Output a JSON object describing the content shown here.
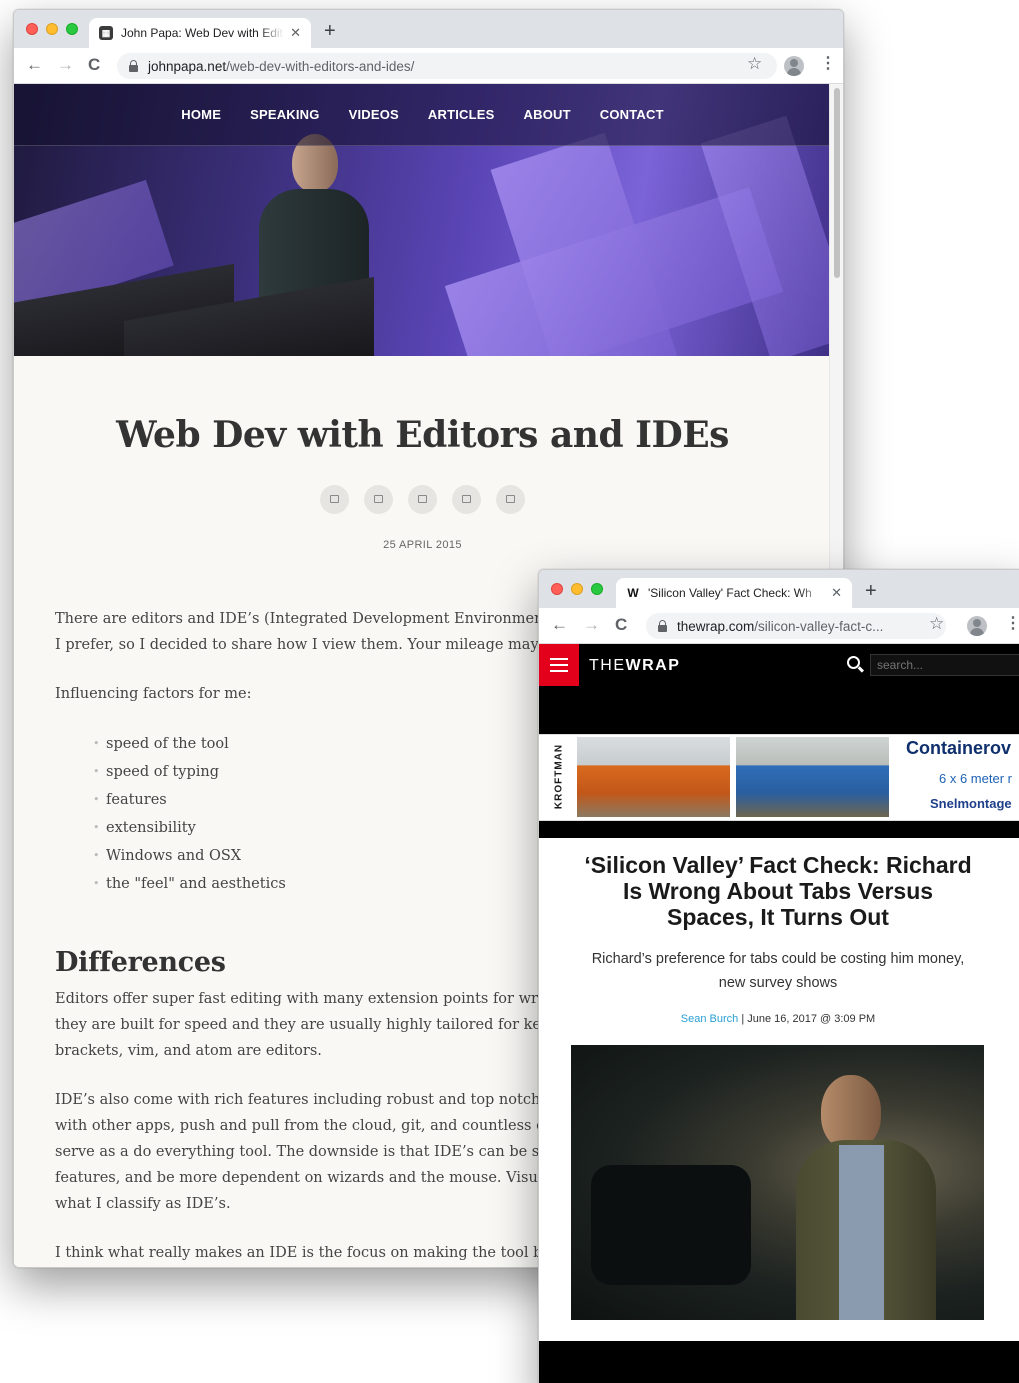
{
  "window1": {
    "tab_title": "John Papa: Web Dev with Editors and IDEs",
    "url_host": "johnpapa.net",
    "url_path": "/web-dev-with-editors-and-ides/",
    "nav": [
      "HOME",
      "SPEAKING",
      "VIDEOS",
      "ARTICLES",
      "ABOUT",
      "CONTACT"
    ],
    "post_title": "Web Dev with Editors and IDEs",
    "post_date": "25 APRIL 2015",
    "intro_line1": "There are editors and IDE’s (Integrated Development Environments)",
    "intro_line2": "I prefer, so I decided to share how I view them. Your mileage may var",
    "factors_intro": "Influencing factors for me:",
    "factors": [
      "speed of the tool",
      "speed of typing",
      "features",
      "extensibility",
      "Windows and OSX",
      "the \"feel\" and aesthetics"
    ],
    "heading_differences": "Differences",
    "editors_line1": "Editors offer super fast editing with many extension points for writi",
    "editors_line2": "they are built for speed and they are usually highly tailored for keyb",
    "editors_line3": "brackets, vim, and atom are editors.",
    "ides_line1": "IDE’s also come with rich features including robust and top notch de",
    "ides_line2": "with other apps, push and pull from the cloud, git, and countless oth",
    "ides_line3": "serve as a do everything tool. The downside is that IDE’s can be slow",
    "ides_line4": "features, and be more dependent on wizards and the mouse. Visual S",
    "ides_line5": "what I classify as IDE’s.",
    "last_line": "I think what really makes an IDE is the focus on making the tool be t"
  },
  "window2": {
    "tab_title": "'Silicon Valley' Fact Check: Wh",
    "tab_favicon": "W",
    "url_host": "thewrap.com",
    "url_path": "/silicon-valley-fact-c...",
    "logo_the": "THE",
    "logo_wrap": "WRAP",
    "search_placeholder": "search...",
    "ad_brand": "KROFTMAN",
    "ad_title": "Containerov",
    "ad_size": "6 x 6 meter r",
    "ad_cta": "Snelmontage",
    "article_title": "‘Silicon Valley’ Fact Check: Richard Is Wrong About Tabs Versus Spaces, It Turns Out",
    "article_dek": "Richard’s preference for tabs could be costing him money, new survey shows",
    "author": "Sean Burch",
    "byline_rest": " | June 16, 2017 @ 3:09 PM"
  },
  "icons": {
    "back": "←",
    "forward": "→",
    "reload": "C",
    "star": "☆",
    "menu": "⋮",
    "close": "✕",
    "new_tab": "+"
  }
}
